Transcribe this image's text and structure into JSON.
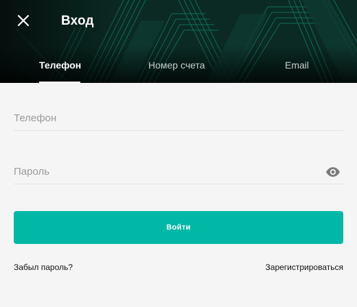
{
  "header": {
    "title": "Вход",
    "close_icon": "close-icon",
    "background_color": "#071a16",
    "pattern_color": "#19c2a0"
  },
  "tabs": [
    {
      "label": "Телефон",
      "active": true
    },
    {
      "label": "Номер счета",
      "active": false
    },
    {
      "label": "Email",
      "active": false
    }
  ],
  "form": {
    "phone_placeholder": "Телефон",
    "password_placeholder": "Пароль",
    "show_password_icon": "eye-icon",
    "submit_label": "Войти",
    "submit_color": "#00b8a5"
  },
  "links": {
    "forgot_password": "Забыл пароль?",
    "register": "Зарегистрироваться"
  }
}
